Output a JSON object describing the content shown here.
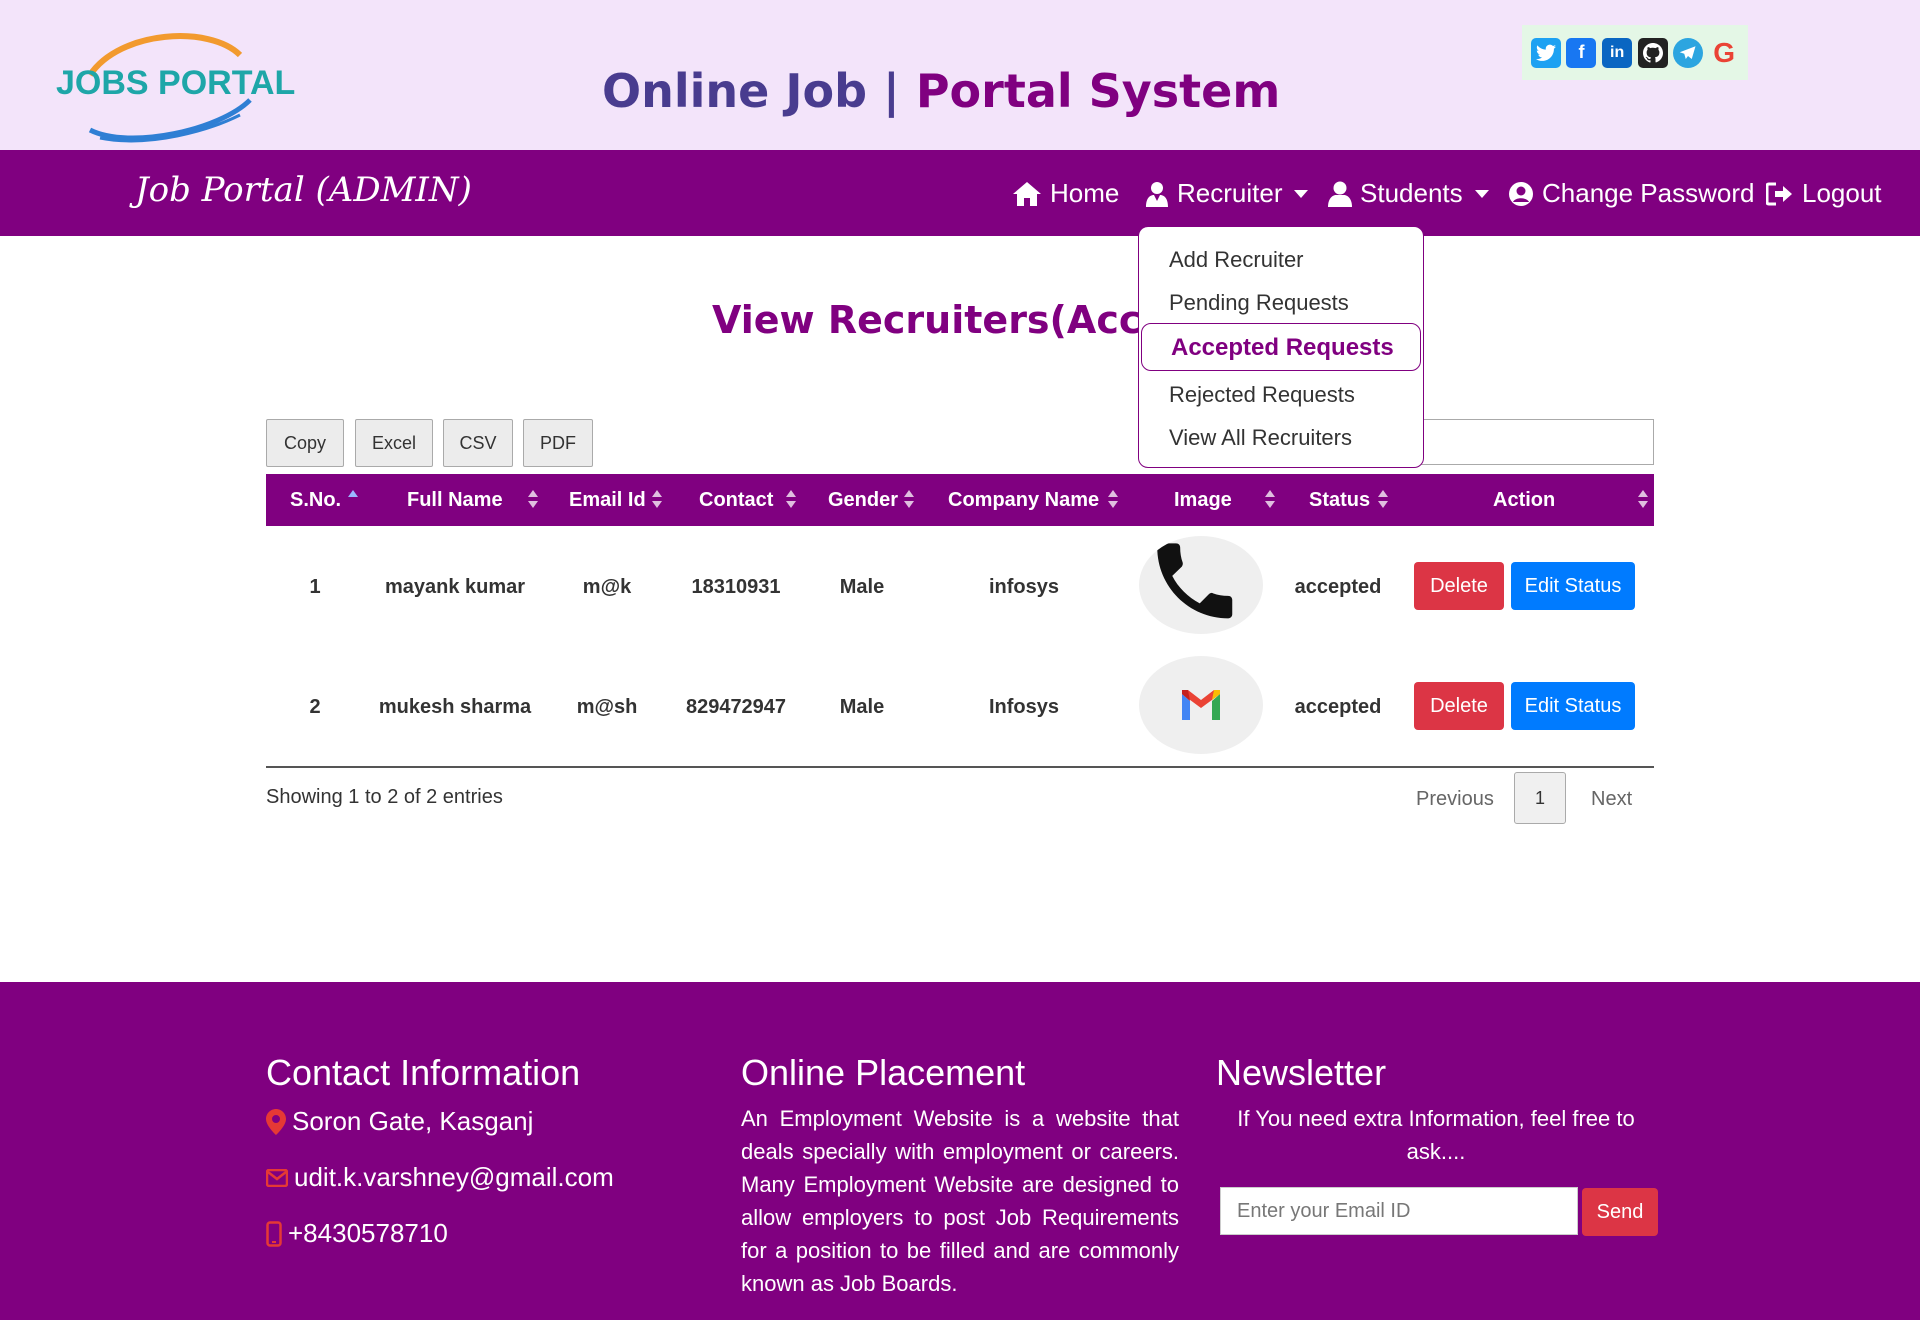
{
  "header": {
    "logo_text": "JOBS PORTAL",
    "title_part1": "Online Job |",
    "title_part2": " Portal System",
    "social_icons": [
      "twitter-icon",
      "facebook-icon",
      "linkedin-icon",
      "github-icon",
      "telegram-icon",
      "google-icon"
    ]
  },
  "navbar": {
    "brand": "Job Portal (ADMIN)",
    "home": "Home",
    "recruiter": "Recruiter",
    "students": "Students",
    "change_password": "Change Password",
    "logout": "Logout"
  },
  "dropdown": {
    "items": [
      "Add Recruiter",
      "Pending Requests",
      "Accepted Requests",
      "Rejected Requests",
      "View All Recruiters"
    ],
    "active": "Accepted Requests"
  },
  "page": {
    "title": "View Recruiters(Accept"
  },
  "export_buttons": [
    "Copy",
    "Excel",
    "CSV",
    "PDF"
  ],
  "table": {
    "headers": [
      "S.No.",
      "Full Name",
      "Email Id",
      "Contact",
      "Gender",
      "Company Name",
      "Image",
      "Status",
      "Action"
    ],
    "rows": [
      {
        "sno": "1",
        "name": "mayank kumar",
        "email": "m@k",
        "contact": "18310931",
        "gender": "Male",
        "company": "infosys",
        "image": "phone-icon",
        "status": "accepted",
        "delete": "Delete",
        "edit": "Edit Status"
      },
      {
        "sno": "2",
        "name": "mukesh sharma",
        "email": "m@sh",
        "contact": "829472947",
        "gender": "Male",
        "company": "Infosys",
        "image": "gmail-icon",
        "status": "accepted",
        "delete": "Delete",
        "edit": "Edit Status"
      }
    ],
    "info": "Showing 1 to 2 of 2 entries",
    "pagination": {
      "previous": "Previous",
      "page": "1",
      "next": "Next"
    }
  },
  "footer": {
    "contact": {
      "heading": "Contact Information",
      "address": "Soron Gate, Kasganj",
      "email": "udit.k.varshney@gmail.com",
      "phone": "+8430578710"
    },
    "placement": {
      "heading": "Online Placement",
      "text": "An Employment Website is a website that deals specially with employment or careers. Many Employment Website are designed to allow employers to post Job Requirements for a position to be filled and are commonly known as Job Boards."
    },
    "newsletter": {
      "heading": "Newsletter",
      "text": "If You need extra Information, feel free to ask....",
      "placeholder": "Enter your Email ID",
      "send": "Send"
    }
  },
  "colors": {
    "primary": "#800080",
    "header_bg": "#f3e4fa",
    "danger": "#dc3545",
    "info": "#007bff"
  }
}
